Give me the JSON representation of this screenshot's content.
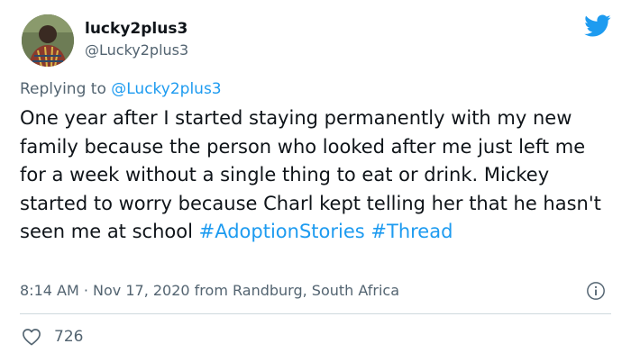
{
  "author": {
    "display_name": "lucky2plus3",
    "handle": "@Lucky2plus3"
  },
  "reply": {
    "prefix": "Replying to",
    "mention": "@Lucky2plus3"
  },
  "tweet": {
    "text": "One year after I started staying permanently with my new family because the person who looked after me just left me for a week without a single thing to eat or drink. Mickey started to worry because Charl kept telling her that he hasn't seen me at school",
    "hashtags": [
      "#AdoptionStories",
      "#Thread"
    ],
    "timestamp": "8:14 AM · Nov 17, 2020 from Randburg, South Africa"
  },
  "stats": {
    "likes": "726"
  },
  "icons": {
    "brand": "twitter-bird-icon",
    "info": "info-icon",
    "like": "heart-icon"
  },
  "colors": {
    "accent": "#1d9bf0",
    "text": "#0f1419",
    "muted": "#536471",
    "divider": "#cfd9de"
  }
}
